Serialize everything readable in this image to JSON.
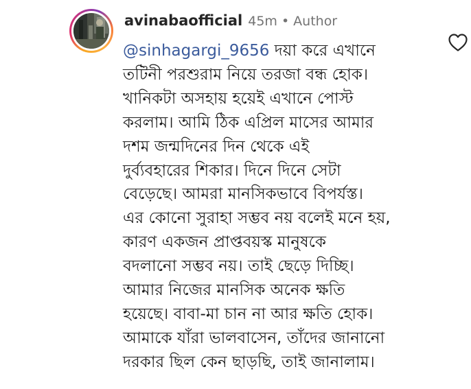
{
  "comment": {
    "username": "avinabaofficial",
    "time": "45m",
    "separator": "•",
    "role_label": "Author",
    "mention": "@sinhagargi_9656",
    "lines": [
      "দয়া করে এখানে",
      "তটিনী পরশুরাম নিয়ে তরজা বন্ধ হোক।",
      "খানিকটা অসহায় হয়েই এখানে পোস্ট",
      "করলাম। আমি ঠিক এপ্রিল মাসের আমার",
      "দশম জন্মদিনের দিন থেকে এই",
      "দুর্ব্যবহারের শিকার। দিনে দিনে সেটা",
      "বেড়েছে। আমরা মানসিকভাবে বিপর্যস্ত।",
      "এর কোনো সুরাহা সম্ভব নয় বলেই মনে হয়,",
      "কারণ একজন প্রাপ্তবয়স্ক মানুষকে",
      "বদলানো সম্ভব নয়। তাই ছেড়ে দিচ্ছি।",
      "আমার নিজের মানসিক অনেক ক্ষতি",
      "হয়েছে। বাবা-মা চান না আর ক্ষতি হোক।",
      "আমাকে যাঁরা ভালবাসেন, তাঁদের জানানো",
      "দরকার ছিল কেন ছাড়ছি, তাই জানালাম।"
    ]
  },
  "icons": {
    "like": "heart-outline-icon",
    "avatar": "profile-photo"
  },
  "colors": {
    "username": "#262626",
    "meta": "#737373",
    "mention": "#3b5b9c",
    "text": "#1c1c1c",
    "story_ring_start": "#f9a825",
    "story_ring_end": "#c13584"
  }
}
